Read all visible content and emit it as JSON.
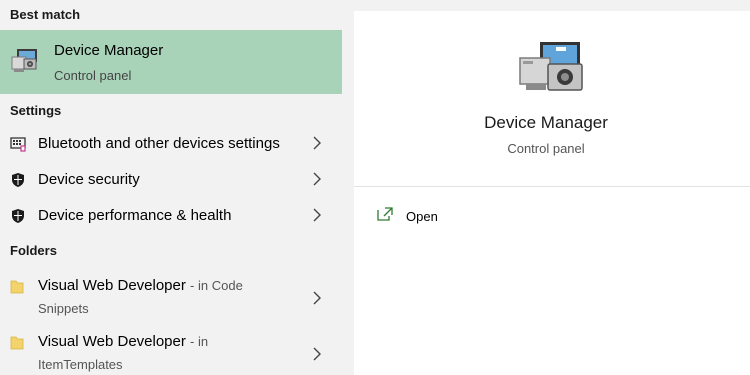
{
  "left_panel": {
    "best_match_header": "Best match",
    "best_match": {
      "title": "Device Manager",
      "subtitle": "Control panel",
      "highlight_color": "#a9d3b8"
    },
    "settings_header": "Settings",
    "settings": [
      {
        "label": "Bluetooth and other devices settings",
        "icon": "keyboard-device-icon"
      },
      {
        "label": "Device security",
        "icon": "shield-icon"
      },
      {
        "label": "Device performance & health",
        "icon": "shield-icon"
      }
    ],
    "folders_header": "Folders",
    "folders": [
      {
        "title": "Visual Web Developer",
        "location_prefix": "- in Code",
        "location_rest": "Snippets",
        "icon": "folder-icon"
      },
      {
        "title": "Visual Web Developer",
        "location_prefix": "- in",
        "location_rest": "ItemTemplates",
        "icon": "folder-icon"
      }
    ]
  },
  "detail_panel": {
    "title": "Device Manager",
    "subtitle": "Control panel",
    "actions": [
      {
        "label": "Open",
        "icon": "open-external-icon"
      }
    ]
  }
}
